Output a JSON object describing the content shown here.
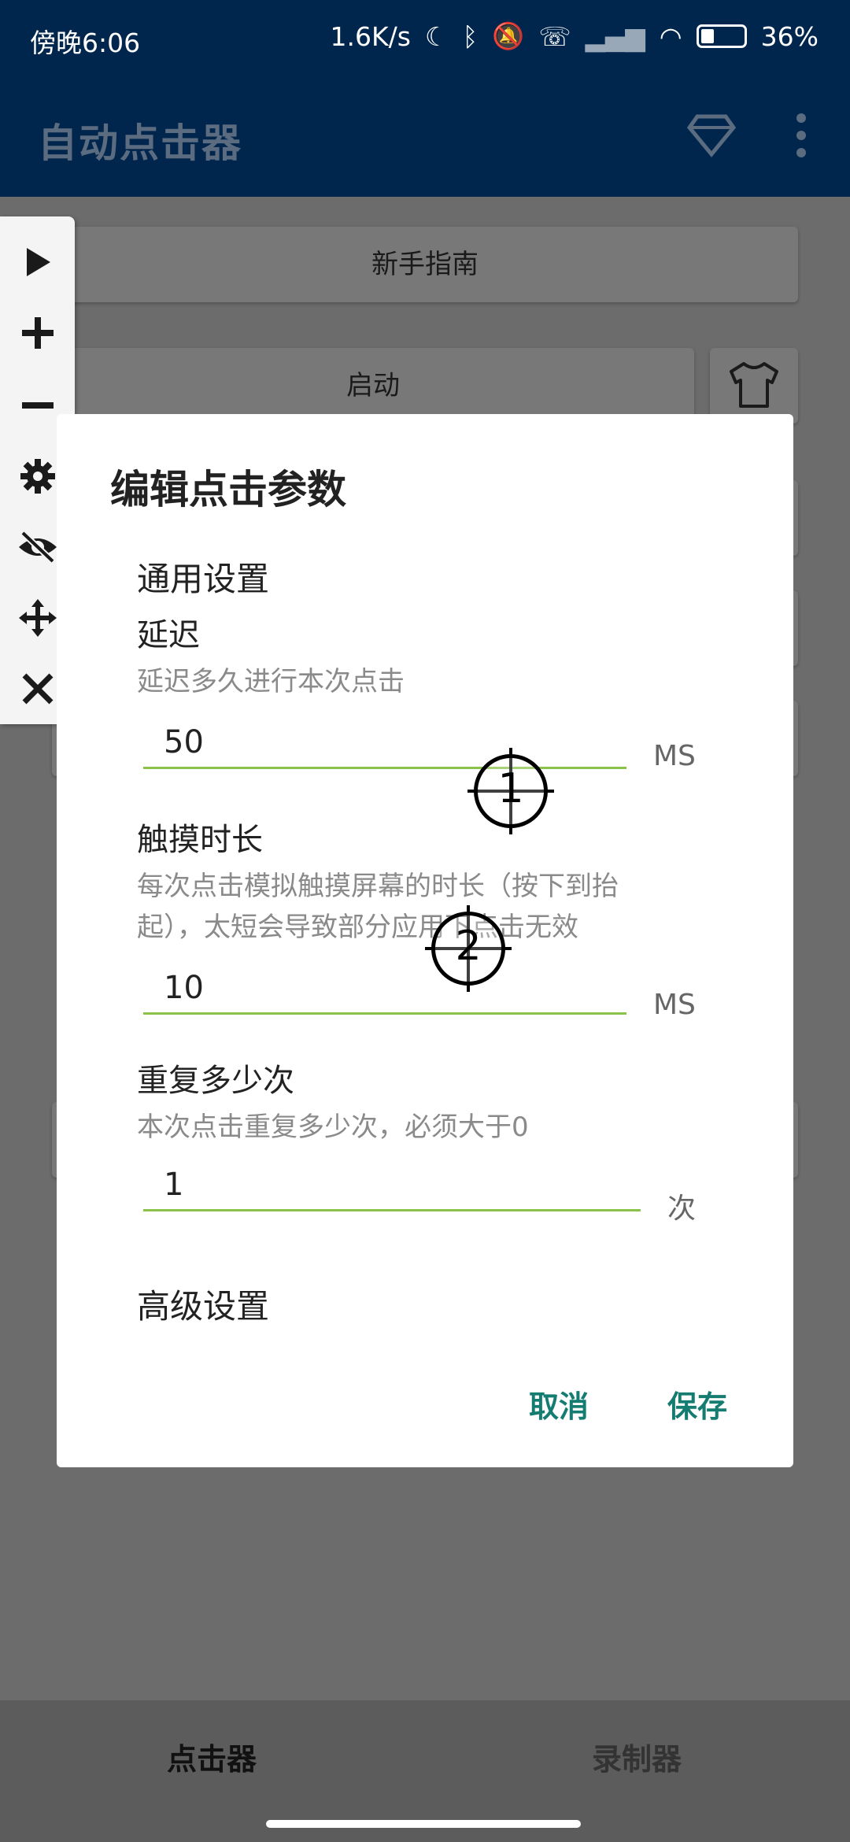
{
  "status_bar": {
    "time": "傍晚6:06",
    "network_speed": "1.6K/s",
    "battery": "36%",
    "icons": [
      "moon-icon",
      "bluetooth-icon",
      "mute-icon",
      "call-icon",
      "signal-icon",
      "wifi-icon",
      "battery-icon"
    ]
  },
  "app_bar": {
    "title": "自动点击器",
    "icons": [
      "diamond-icon",
      "more-vert-icon"
    ]
  },
  "background": {
    "guide_button": "新手指南",
    "start_button": "启动"
  },
  "toolbar": {
    "icons": [
      "play-icon",
      "plus-icon",
      "minus-icon",
      "gear-icon",
      "eye-off-icon",
      "move-icon",
      "close-icon"
    ]
  },
  "dialog": {
    "title": "编辑点击参数",
    "general_section": "通用设置",
    "delay": {
      "label": "延迟",
      "description": "延迟多久进行本次点击",
      "value": "50",
      "unit": "MS"
    },
    "touch_duration": {
      "label": "触摸时长",
      "description_line1": "每次点击模拟触摸屏幕的时长（按下到抬",
      "description_line2": "起），太短会导致部分应用下点击无效",
      "value": "10",
      "unit": "MS"
    },
    "repeat": {
      "label": "重复多少次",
      "description": "本次点击重复多少次，必须大于0",
      "value": "1",
      "unit": "次"
    },
    "advanced_section": "高级设置",
    "cancel_label": "取消",
    "save_label": "保存"
  },
  "markers": [
    "1",
    "2"
  ],
  "bottom_nav": {
    "tabs": [
      "点击器",
      "录制器"
    ]
  }
}
